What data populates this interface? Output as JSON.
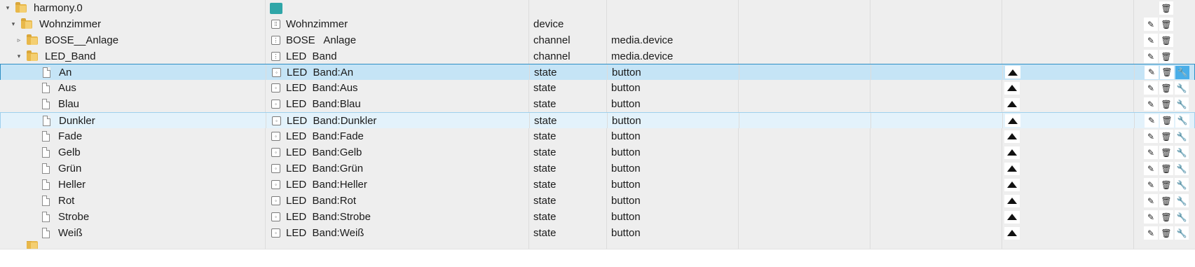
{
  "rows": [
    {
      "name": "harmony.0",
      "title": "",
      "type": "",
      "role": "",
      "indent": 0,
      "toggle": "▾",
      "icon": "folder",
      "title_icon": "teal",
      "has_button": false,
      "actions": [
        "delete"
      ],
      "state": "normal"
    },
    {
      "name": "Wohnzimmer",
      "title": "Wohnzimmer",
      "type": "device",
      "role": "",
      "indent": 1,
      "toggle": "▾",
      "icon": "folder",
      "title_icon": "device",
      "has_button": false,
      "actions": [
        "edit",
        "delete"
      ],
      "state": "normal"
    },
    {
      "name": "BOSE__Anlage",
      "title": "BOSE   Anlage",
      "type": "channel",
      "role": "media.device",
      "indent": 2,
      "toggle": "▹",
      "icon": "folder",
      "title_icon": "channel",
      "has_button": false,
      "actions": [
        "edit",
        "delete"
      ],
      "state": "normal"
    },
    {
      "name": "LED_Band",
      "title": "LED  Band",
      "type": "channel",
      "role": "media.device",
      "indent": 2,
      "toggle": "▾",
      "icon": "folder",
      "title_icon": "channel",
      "has_button": false,
      "actions": [
        "edit",
        "delete"
      ],
      "state": "normal"
    },
    {
      "name": "An",
      "title": "LED  Band:An",
      "type": "state",
      "role": "button",
      "indent": 3,
      "toggle": "",
      "icon": "file",
      "title_icon": "state",
      "has_button": true,
      "actions": [
        "edit",
        "delete",
        "settings"
      ],
      "state": "selected"
    },
    {
      "name": "Aus",
      "title": "LED  Band:Aus",
      "type": "state",
      "role": "button",
      "indent": 3,
      "toggle": "",
      "icon": "file",
      "title_icon": "state",
      "has_button": true,
      "actions": [
        "edit",
        "delete",
        "settings"
      ],
      "state": "normal"
    },
    {
      "name": "Blau",
      "title": "LED  Band:Blau",
      "type": "state",
      "role": "button",
      "indent": 3,
      "toggle": "",
      "icon": "file",
      "title_icon": "state",
      "has_button": true,
      "actions": [
        "edit",
        "delete",
        "settings"
      ],
      "state": "normal"
    },
    {
      "name": "Dunkler",
      "title": "LED  Band:Dunkler",
      "type": "state",
      "role": "button",
      "indent": 3,
      "toggle": "",
      "icon": "file",
      "title_icon": "state",
      "has_button": true,
      "actions": [
        "edit",
        "delete",
        "settings"
      ],
      "state": "hover"
    },
    {
      "name": "Fade",
      "title": "LED  Band:Fade",
      "type": "state",
      "role": "button",
      "indent": 3,
      "toggle": "",
      "icon": "file",
      "title_icon": "state",
      "has_button": true,
      "actions": [
        "edit",
        "delete",
        "settings"
      ],
      "state": "normal"
    },
    {
      "name": "Gelb",
      "title": "LED  Band:Gelb",
      "type": "state",
      "role": "button",
      "indent": 3,
      "toggle": "",
      "icon": "file",
      "title_icon": "state",
      "has_button": true,
      "actions": [
        "edit",
        "delete",
        "settings"
      ],
      "state": "normal"
    },
    {
      "name": "Grün",
      "title": "LED  Band:Grün",
      "type": "state",
      "role": "button",
      "indent": 3,
      "toggle": "",
      "icon": "file",
      "title_icon": "state",
      "has_button": true,
      "actions": [
        "edit",
        "delete",
        "settings"
      ],
      "state": "normal"
    },
    {
      "name": "Heller",
      "title": "LED  Band:Heller",
      "type": "state",
      "role": "button",
      "indent": 3,
      "toggle": "",
      "icon": "file",
      "title_icon": "state",
      "has_button": true,
      "actions": [
        "edit",
        "delete",
        "settings"
      ],
      "state": "normal"
    },
    {
      "name": "Rot",
      "title": "LED  Band:Rot",
      "type": "state",
      "role": "button",
      "indent": 3,
      "toggle": "",
      "icon": "file",
      "title_icon": "state",
      "has_button": true,
      "actions": [
        "edit",
        "delete",
        "settings"
      ],
      "state": "normal"
    },
    {
      "name": "Strobe",
      "title": "LED  Band:Strobe",
      "type": "state",
      "role": "button",
      "indent": 3,
      "toggle": "",
      "icon": "file",
      "title_icon": "state",
      "has_button": true,
      "actions": [
        "edit",
        "delete",
        "settings"
      ],
      "state": "normal"
    },
    {
      "name": "Weiß",
      "title": "LED  Band:Weiß",
      "type": "state",
      "role": "button",
      "indent": 3,
      "toggle": "",
      "icon": "file",
      "title_icon": "state",
      "has_button": true,
      "actions": [
        "edit",
        "delete",
        "settings"
      ],
      "state": "normal"
    },
    {
      "name": "",
      "title": "",
      "type": "",
      "role": "",
      "indent": 2,
      "toggle": "",
      "icon": "folder",
      "title_icon": "",
      "has_button": false,
      "actions": [],
      "state": "normal"
    }
  ],
  "icons": {
    "edit": "pencil-icon",
    "delete": "trash-icon",
    "settings": "wrench-icon",
    "button": "button-icon"
  },
  "colors": {
    "selected": "#c5e4f6",
    "hover": "#e3f2fb",
    "row": "#eeeeee",
    "accent": "#4aaee8",
    "folder": "#e8b84a"
  }
}
